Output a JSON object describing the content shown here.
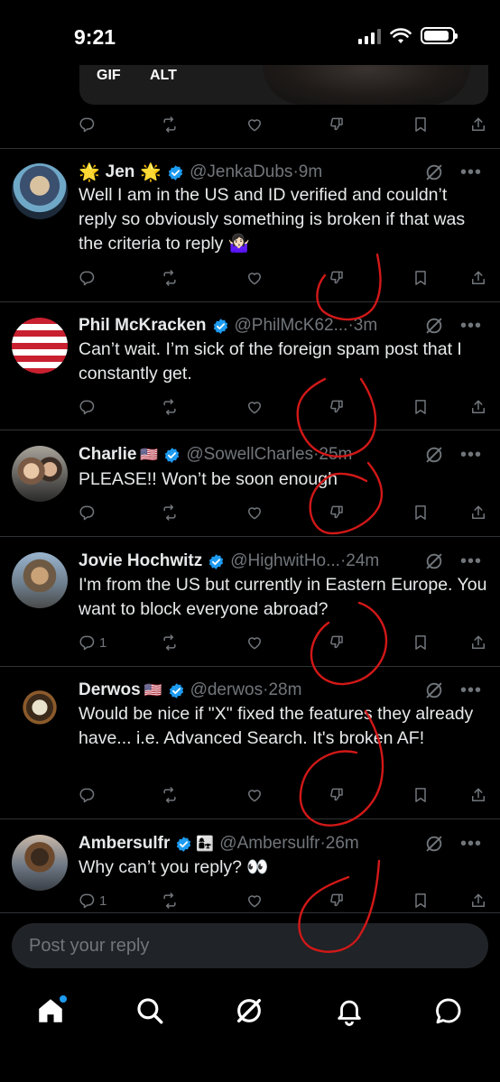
{
  "status_bar": {
    "time": "9:21"
  },
  "media": {
    "gif_badge": "GIF",
    "alt_badge": "ALT"
  },
  "tweets": [
    {
      "name": "Jen",
      "name_emoji_left": "🌟",
      "name_emoji_right": "🌟",
      "handle": "@JenkaDubs",
      "time": "9m",
      "text": "Well I am in the US and ID verified and couldn’t reply so obviously something is broken if that was the criteria to reply 🤷🏻‍♀️",
      "replies": ""
    },
    {
      "name": "Phil McKracken",
      "handle": "@PhilMcK62...",
      "time": "3m",
      "text": "Can’t wait. I’m sick of the foreign spam post that I constantly get.",
      "replies": ""
    },
    {
      "name": "Charlie",
      "flag": "🇺🇸",
      "handle": "@SowellCharles",
      "time": "25m",
      "text": "PLEASE!! Won’t be soon enough",
      "replies": ""
    },
    {
      "name": "Jovie Hochwitz",
      "handle": "@HighwitHo...",
      "time": "24m",
      "text": "I'm from the US but currently in Eastern Europe. You want to block everyone abroad?",
      "replies": "1"
    },
    {
      "name": "Derwos",
      "flag": "🇺🇸",
      "handle": "@derwos",
      "time": "28m",
      "text": "Would be nice if \"X\" fixed the features they already have... i.e. Advanced Search. It's broken AF!",
      "replies": ""
    },
    {
      "name": "Ambersulfr",
      "affiliate_emoji": "👩‍👧",
      "handle": "@Ambersulfr",
      "time": "26m",
      "text": "Why can’t you reply? 👀",
      "replies": "1"
    }
  ],
  "reply_bar": {
    "placeholder": "Post your reply"
  },
  "nav": [
    "home-icon",
    "search-icon",
    "grok-icon",
    "notifications-icon",
    "messages-icon"
  ],
  "colors": {
    "accent": "#1d9bf0",
    "muted": "#71767b",
    "annotation": "#d21818"
  }
}
